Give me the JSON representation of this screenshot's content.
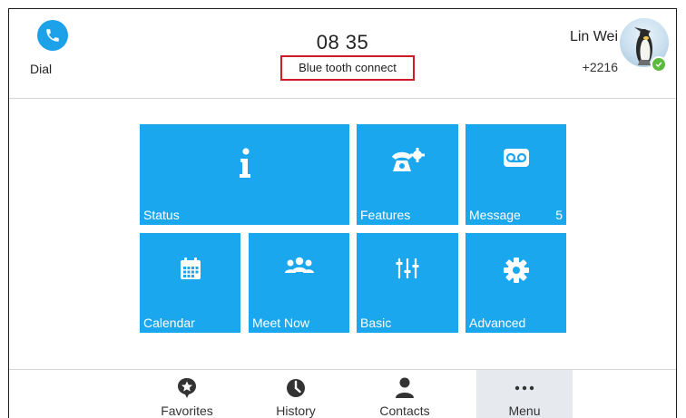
{
  "header": {
    "dial_label": "Dial",
    "time": "08 35",
    "status_text": "Blue tooth connect",
    "user_name": "Lin Wei",
    "user_ext": "+2216",
    "presence": "online"
  },
  "tiles": [
    {
      "key": "status",
      "label": "Status",
      "icon": "info-icon"
    },
    {
      "key": "features",
      "label": "Features",
      "icon": "phone-gear-icon"
    },
    {
      "key": "message",
      "label": "Message",
      "badge": "5",
      "icon": "voicemail-icon"
    },
    {
      "key": "calendar",
      "label": "Calendar",
      "icon": "calendar-icon"
    },
    {
      "key": "meet_now",
      "label": "Meet Now",
      "icon": "people-icon"
    },
    {
      "key": "basic",
      "label": "Basic",
      "icon": "sliders-icon"
    },
    {
      "key": "advanced",
      "label": "Advanced",
      "icon": "gear-icon"
    }
  ],
  "navbar": {
    "items": [
      {
        "label": "Favorites",
        "icon": "star-badge-icon"
      },
      {
        "label": "History",
        "icon": "clock-icon"
      },
      {
        "label": "Contacts",
        "icon": "person-icon"
      },
      {
        "label": "Menu",
        "icon": "more-icon",
        "active": true
      }
    ]
  },
  "colors": {
    "tile": "#1aa7ee",
    "dial_button": "#1da1e8",
    "status_border": "#d01a26",
    "presence": "#5bbb3e",
    "nav_active_bg": "#e6e9ee"
  }
}
